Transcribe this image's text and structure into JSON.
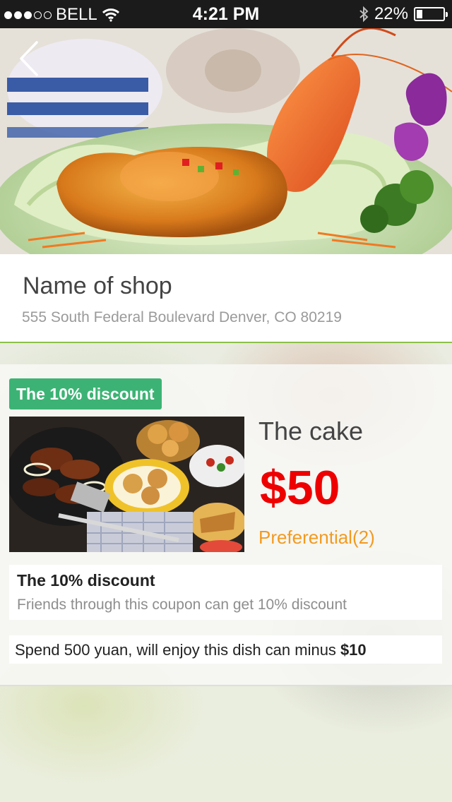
{
  "status_bar": {
    "carrier": "BELL",
    "time": "4:21 PM",
    "battery": "22%",
    "battery_level": 0.22
  },
  "shop": {
    "name": "Name of shop",
    "address": "555 South Federal Boulevard Denver, CO 80219"
  },
  "deal": {
    "badge": "The 10% discount",
    "dish_name": "The cake",
    "price": "$50",
    "preferential": "Preferential(2)",
    "discount_title": "The 10% discount",
    "discount_desc": "Friends through this coupon can get 10% discount",
    "spend_text": "Spend 500 yuan, will enjoy this dish can minus",
    "spend_amount": "$10"
  },
  "icons": {
    "back": "chevron-left-icon",
    "wifi": "wifi-icon",
    "bluetooth": "bluetooth-icon",
    "battery": "battery-icon"
  },
  "colors": {
    "badge_bg": "#3cb374",
    "price": "#ee0000",
    "preferential": "#f39a1f",
    "divider": "#8cc04b"
  }
}
